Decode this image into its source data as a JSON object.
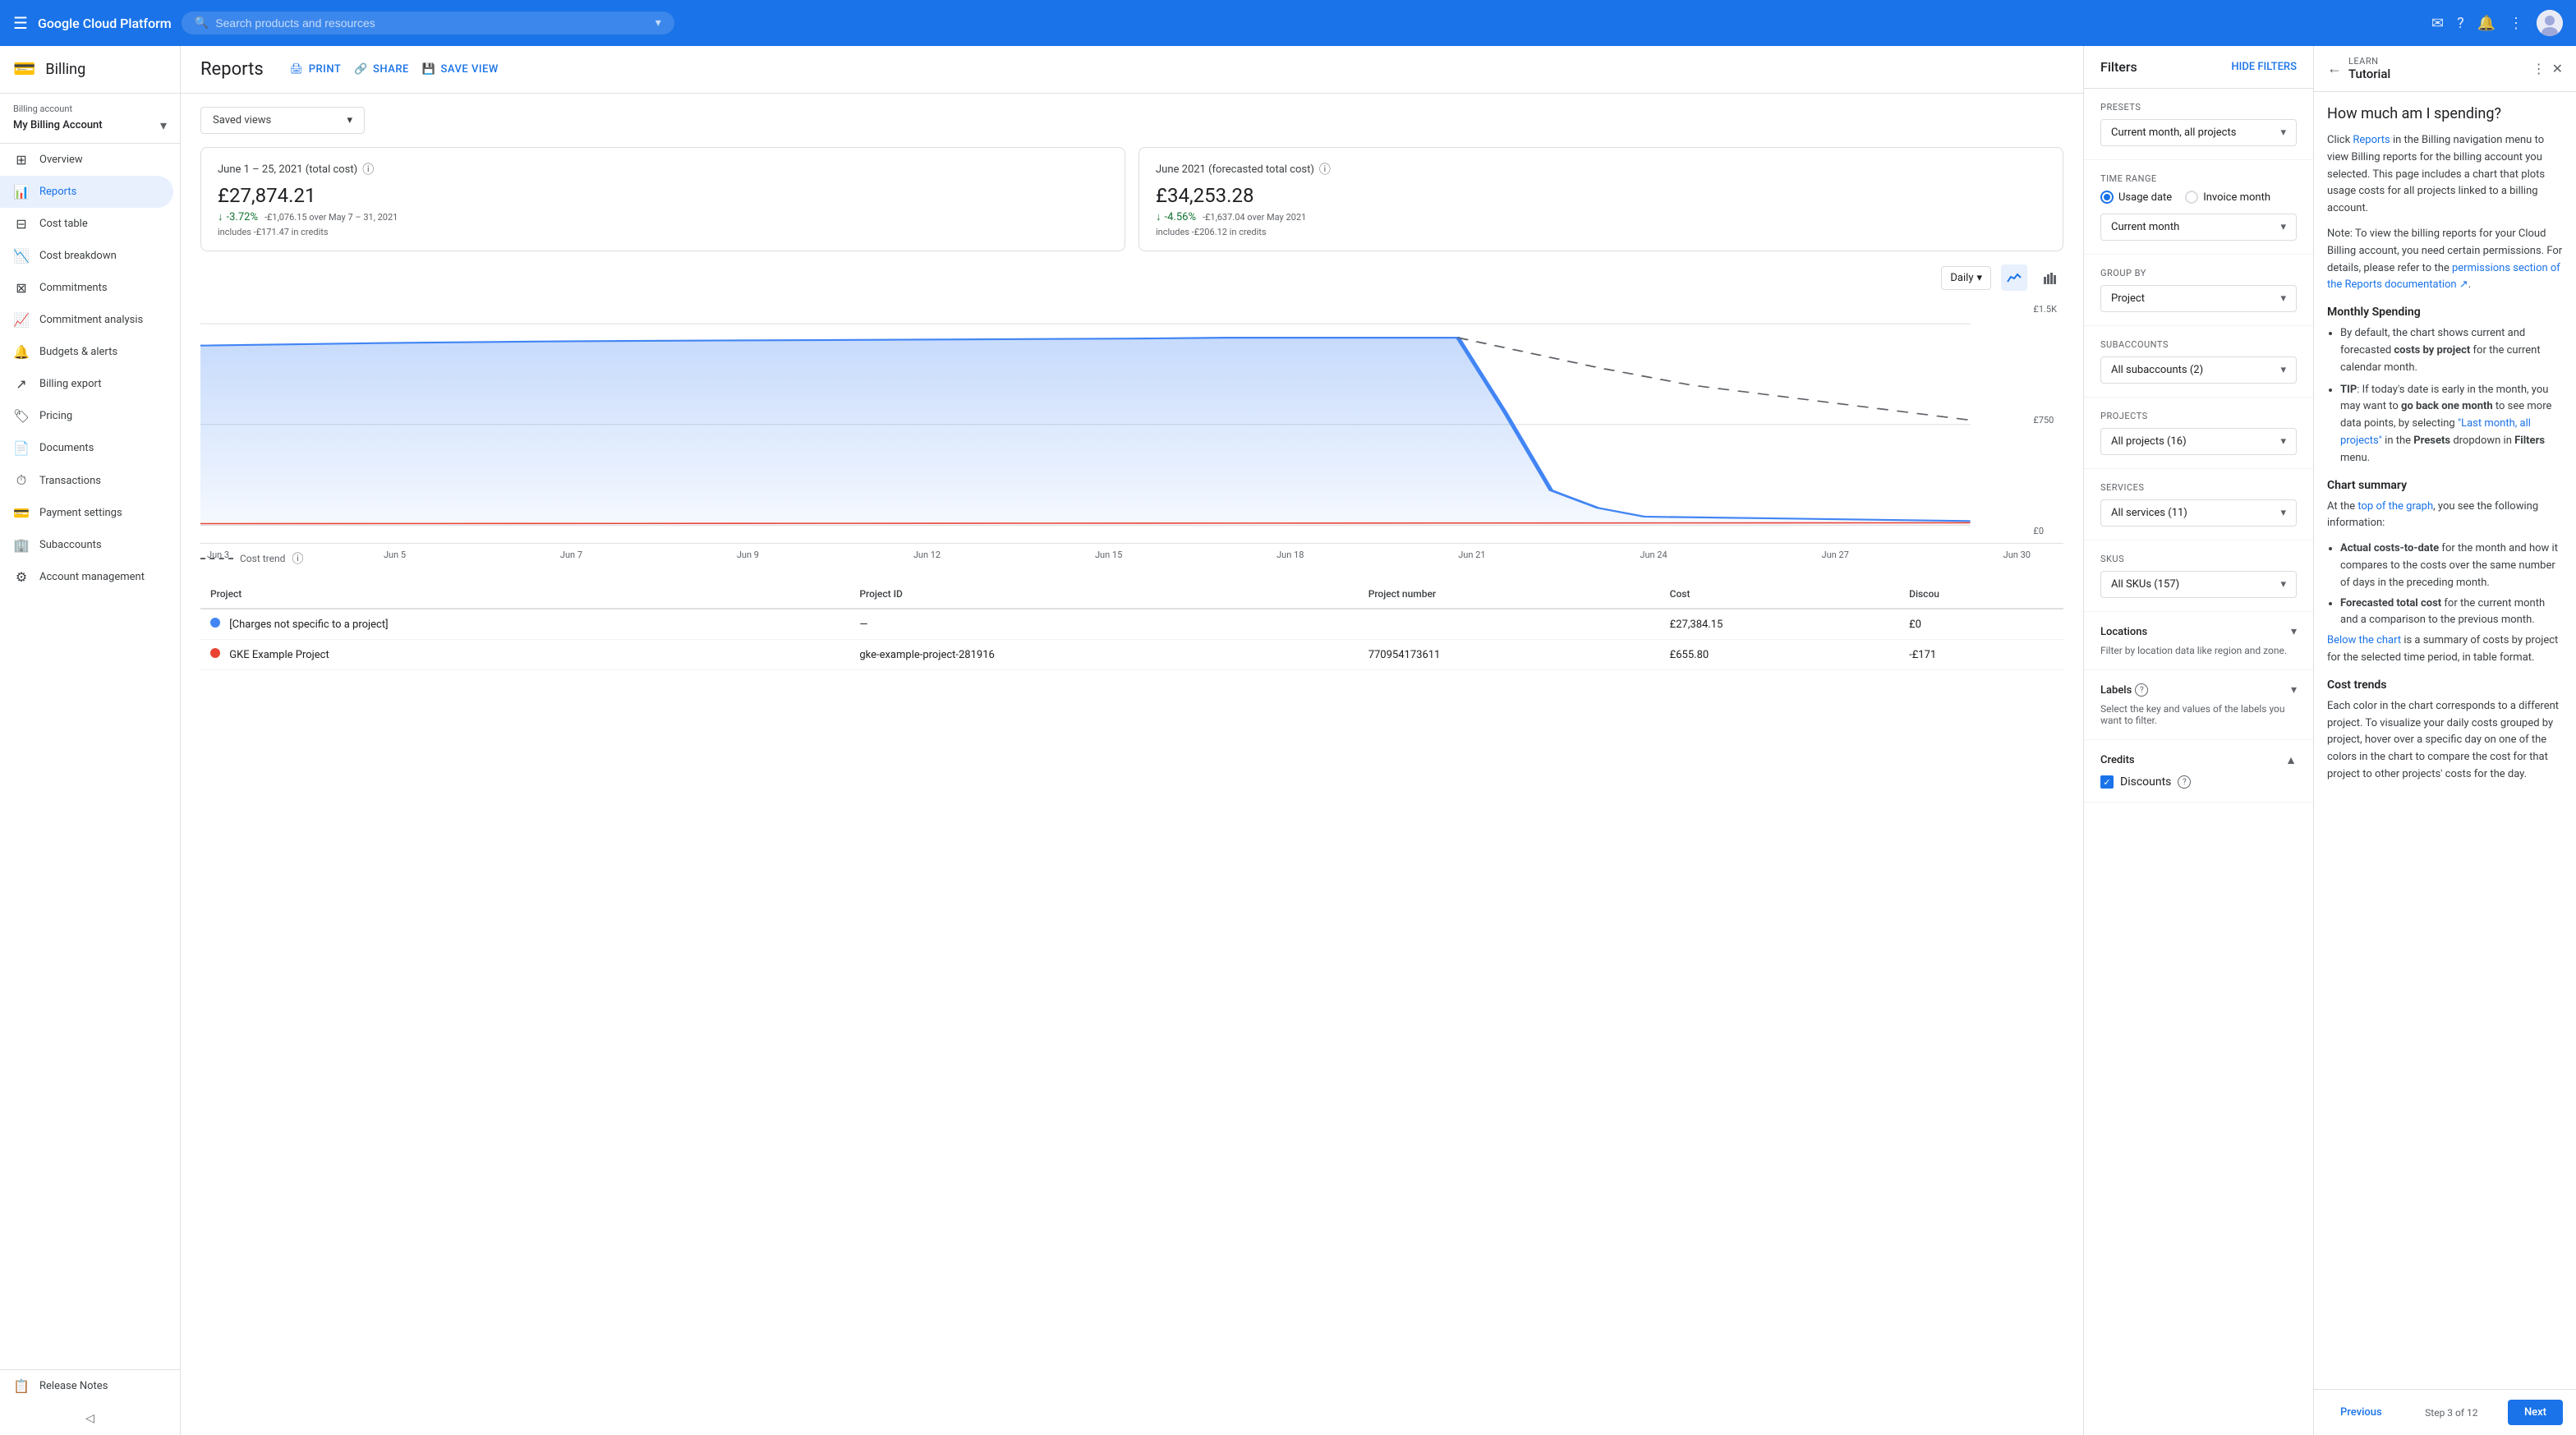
{
  "topbar": {
    "menu_icon": "☰",
    "logo": "Google Cloud Platform",
    "search_placeholder": "Search products and resources",
    "expand_icon": "▾"
  },
  "sidebar": {
    "header_title": "Billing",
    "billing_account_label": "Billing account",
    "billing_account_name": "My Billing Account",
    "nav_items": [
      {
        "id": "overview",
        "label": "Overview",
        "icon": "⊞"
      },
      {
        "id": "reports",
        "label": "Reports",
        "icon": "📊",
        "active": true
      },
      {
        "id": "cost-table",
        "label": "Cost table",
        "icon": "⊟"
      },
      {
        "id": "cost-breakdown",
        "label": "Cost breakdown",
        "icon": "📉"
      },
      {
        "id": "commitments",
        "label": "Commitments",
        "icon": "⊠"
      },
      {
        "id": "commitment-analysis",
        "label": "Commitment analysis",
        "icon": "📈"
      },
      {
        "id": "budgets-alerts",
        "label": "Budgets & alerts",
        "icon": "🔔"
      },
      {
        "id": "billing-export",
        "label": "Billing export",
        "icon": "↗"
      },
      {
        "id": "pricing",
        "label": "Pricing",
        "icon": "🏷"
      },
      {
        "id": "documents",
        "label": "Documents",
        "icon": "📄"
      },
      {
        "id": "transactions",
        "label": "Transactions",
        "icon": "⏱"
      },
      {
        "id": "payment-settings",
        "label": "Payment settings",
        "icon": "💳"
      },
      {
        "id": "subaccounts",
        "label": "Subaccounts",
        "icon": "🏢"
      },
      {
        "id": "account-management",
        "label": "Account management",
        "icon": "⚙"
      }
    ],
    "release_notes": "Release Notes",
    "collapse_icon": "◁"
  },
  "reports": {
    "title": "Reports",
    "print_label": "PRINT",
    "share_label": "SHARE",
    "save_view_label": "SAVE VIEW",
    "saved_views_label": "Saved views",
    "period1": {
      "label": "June 1 – 25, 2021 (total cost)",
      "amount": "£27,874.21",
      "change_pct": "-3.72%",
      "detail1": "includes -£171.47 in credits",
      "detail2": "-£1,076.15 over May 7 – 31, 2021"
    },
    "period2": {
      "label": "June 2021 (forecasted total cost)",
      "amount": "£34,253.28",
      "change_pct": "-4.56%",
      "detail1": "includes -£206.12 in credits",
      "detail2": "-£1,637.04 over May 2021"
    },
    "chart": {
      "granularity": "Daily",
      "y_labels": [
        "£1.5K",
        "£750",
        "£0"
      ],
      "x_labels": [
        "Jun 3",
        "Jun 5",
        "Jun 7",
        "Jun 9",
        "Jun 12",
        "Jun 15",
        "Jun 18",
        "Jun 21",
        "Jun 24",
        "Jun 27",
        "Jun 30"
      ],
      "cost_trend_label": "Cost trend"
    },
    "table": {
      "headers": [
        "Project",
        "Project ID",
        "Project number",
        "Cost",
        "Discou"
      ],
      "rows": [
        {
          "dot_color": "#4285f4",
          "project": "[Charges not specific to a project]",
          "project_id": "—",
          "project_number": "",
          "cost": "£27,384.15",
          "discount": "£0"
        },
        {
          "dot_color": "#ea4335",
          "project": "GKE Example Project",
          "project_id": "gke-example-project-281916",
          "project_number": "770954173611",
          "cost": "£655.80",
          "discount": "-£171"
        }
      ]
    }
  },
  "filters": {
    "title": "Filters",
    "hide_filters_label": "HIDE FILTERS",
    "presets_label": "Presets",
    "presets_value": "Current month, all projects",
    "time_range_label": "Time range",
    "usage_date_label": "Usage date",
    "invoice_month_label": "Invoice month",
    "current_month_value": "Current month",
    "group_by_label": "Group by",
    "group_by_value": "Project",
    "subaccounts_label": "Subaccounts",
    "subaccounts_value": "All subaccounts (2)",
    "projects_label": "Projects",
    "projects_value": "All projects (16)",
    "services_label": "Services",
    "services_value": "All services (11)",
    "skus_label": "SKUs",
    "skus_value": "All SKUs (157)",
    "locations_label": "Locations",
    "locations_desc": "Filter by location data like region and zone.",
    "labels_label": "Labels",
    "labels_desc": "Select the key and values of the labels you want to filter.",
    "credits_label": "Credits",
    "discounts_label": "Discounts",
    "discounts_checked": true
  },
  "tutorial": {
    "learn_label": "LEARN",
    "title": "Tutorial",
    "main_title": "How much am I spending?",
    "intro": "Click Reports in the Billing navigation menu to view Billing reports for the billing account you selected. This page includes a chart that plots usage costs for all projects linked to a billing account.",
    "note": "Note: To view the billing reports for your Cloud Billing account, you need certain permissions. For details, please refer to the permissions section of the Reports documentation ↗.",
    "monthly_spending_title": "Monthly Spending",
    "monthly_spending_items": [
      "By default, the chart shows current and forecasted costs by project for the current calendar month.",
      "TIP: If today's date is early in the month, you may want to go back one month to see more data points, by selecting \"Last month, all projects\" in the Presets dropdown in Filters menu."
    ],
    "chart_summary_title": "Chart summary",
    "chart_summary_intro": "At the top of the graph, you see the following information:",
    "chart_summary_items": [
      "Actual costs-to-date for the month and how it compares to the costs over the same number of days in the preceding month.",
      "Forecasted total cost for the current month and a comparison to the previous month."
    ],
    "below_chart": "Below the chart is a summary of costs by project for the selected time period, in table format.",
    "cost_trends_title": "Cost trends",
    "cost_trends_text": "Each color in the chart corresponds to a different project. To visualize your daily costs grouped by project, hover over a specific day on one of the colors in the chart to compare the cost for that project to other projects' costs for the day.",
    "prev_label": "Previous",
    "step_label": "Step 3 of 12",
    "next_label": "Next"
  }
}
